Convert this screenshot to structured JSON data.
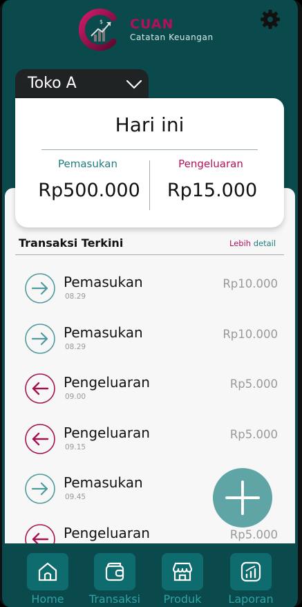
{
  "header": {
    "brand_name": "CUAN",
    "brand_subtitle": "Catatan Keuangan",
    "settings_icon": "gear-icon"
  },
  "store": {
    "selected": "Toko A"
  },
  "summary": {
    "title": "Hari ini",
    "income_label": "Pemasukan",
    "income_value": "Rp500.000",
    "expense_label": "Pengeluaran",
    "expense_value": "Rp15.000"
  },
  "recent": {
    "title": "Transaksi Terkini",
    "more_prefix": "Lebih",
    "more_suffix": " detail",
    "items": [
      {
        "type": "income",
        "name": "Pemasukan",
        "time": "08.29",
        "amount": "Rp10.000"
      },
      {
        "type": "income",
        "name": "Pemasukan",
        "time": "08.29",
        "amount": "Rp10.000"
      },
      {
        "type": "expense",
        "name": "Pengeluaran",
        "time": "09.00",
        "amount": "Rp5.000"
      },
      {
        "type": "expense",
        "name": "Pengeluaran",
        "time": "09.15",
        "amount": "Rp5.000"
      },
      {
        "type": "income",
        "name": "Pemasukan",
        "time": "09.45",
        "amount": ""
      },
      {
        "type": "expense",
        "name": "Pengeluaran",
        "time": "",
        "amount": "Rp5.000"
      }
    ]
  },
  "nav": {
    "items": [
      {
        "label": "Home",
        "icon": "home-icon"
      },
      {
        "label": "Transaksi",
        "icon": "wallet-icon"
      },
      {
        "label": "Produk",
        "icon": "store-icon"
      },
      {
        "label": "Laporan",
        "icon": "report-chart-icon"
      }
    ]
  },
  "colors": {
    "background": "#0a4a4c",
    "accent_teal": "#1f7c7e",
    "accent_magenta": "#b3105c",
    "fab": "#5fa5a6",
    "nav_button": "#0f6c6e",
    "nav_label": "#2ea3a5"
  }
}
